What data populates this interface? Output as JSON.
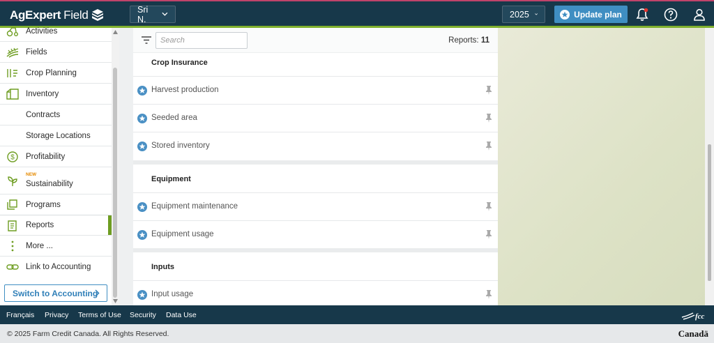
{
  "header": {
    "logo_bold": "AgExpert",
    "logo_regular": "Field",
    "user": "Sri N.",
    "year": "2025",
    "update_label": "Update plan"
  },
  "sidebar": {
    "items": [
      {
        "label": "Activities",
        "icon": "activities-icon"
      },
      {
        "label": "Fields",
        "icon": "fields-icon"
      },
      {
        "label": "Crop Planning",
        "icon": "crop-planning-icon"
      },
      {
        "label": "Inventory",
        "icon": "inventory-icon"
      },
      {
        "label": "Contracts"
      },
      {
        "label": "Storage Locations"
      },
      {
        "label": "Profitability",
        "icon": "dollar-icon"
      },
      {
        "label": "Sustainability",
        "icon": "sprout-icon",
        "badge": "NEW"
      },
      {
        "label": "Programs",
        "icon": "programs-icon"
      },
      {
        "label": "Reports",
        "icon": "reports-icon",
        "active": true
      },
      {
        "label": "More ...",
        "icon": "more-icon"
      },
      {
        "label": "Link to Accounting",
        "icon": "link-icon"
      }
    ],
    "switch_label": "Switch to Accounting"
  },
  "reports": {
    "search_placeholder": "Search",
    "count_label": "Reports:",
    "count_value": "11",
    "sections": [
      {
        "title": "Crop Insurance",
        "items": [
          "Harvest production",
          "Seeded area",
          "Stored inventory"
        ]
      },
      {
        "title": "Equipment",
        "items": [
          "Equipment maintenance",
          "Equipment usage"
        ]
      },
      {
        "title": "Inputs",
        "items": [
          "Input usage"
        ]
      }
    ]
  },
  "footer": {
    "links": [
      "Français",
      "Privacy",
      "Terms of Use",
      "Security",
      "Data Use"
    ],
    "copyright": "© 2025 Farm Credit Canada. All Rights Reserved.",
    "canada": "Canadä"
  },
  "colors": {
    "topbar": "#17384a",
    "accent_green": "#7fb02e",
    "button_blue": "#3f8ec2",
    "star_blue": "#4a90c4"
  }
}
